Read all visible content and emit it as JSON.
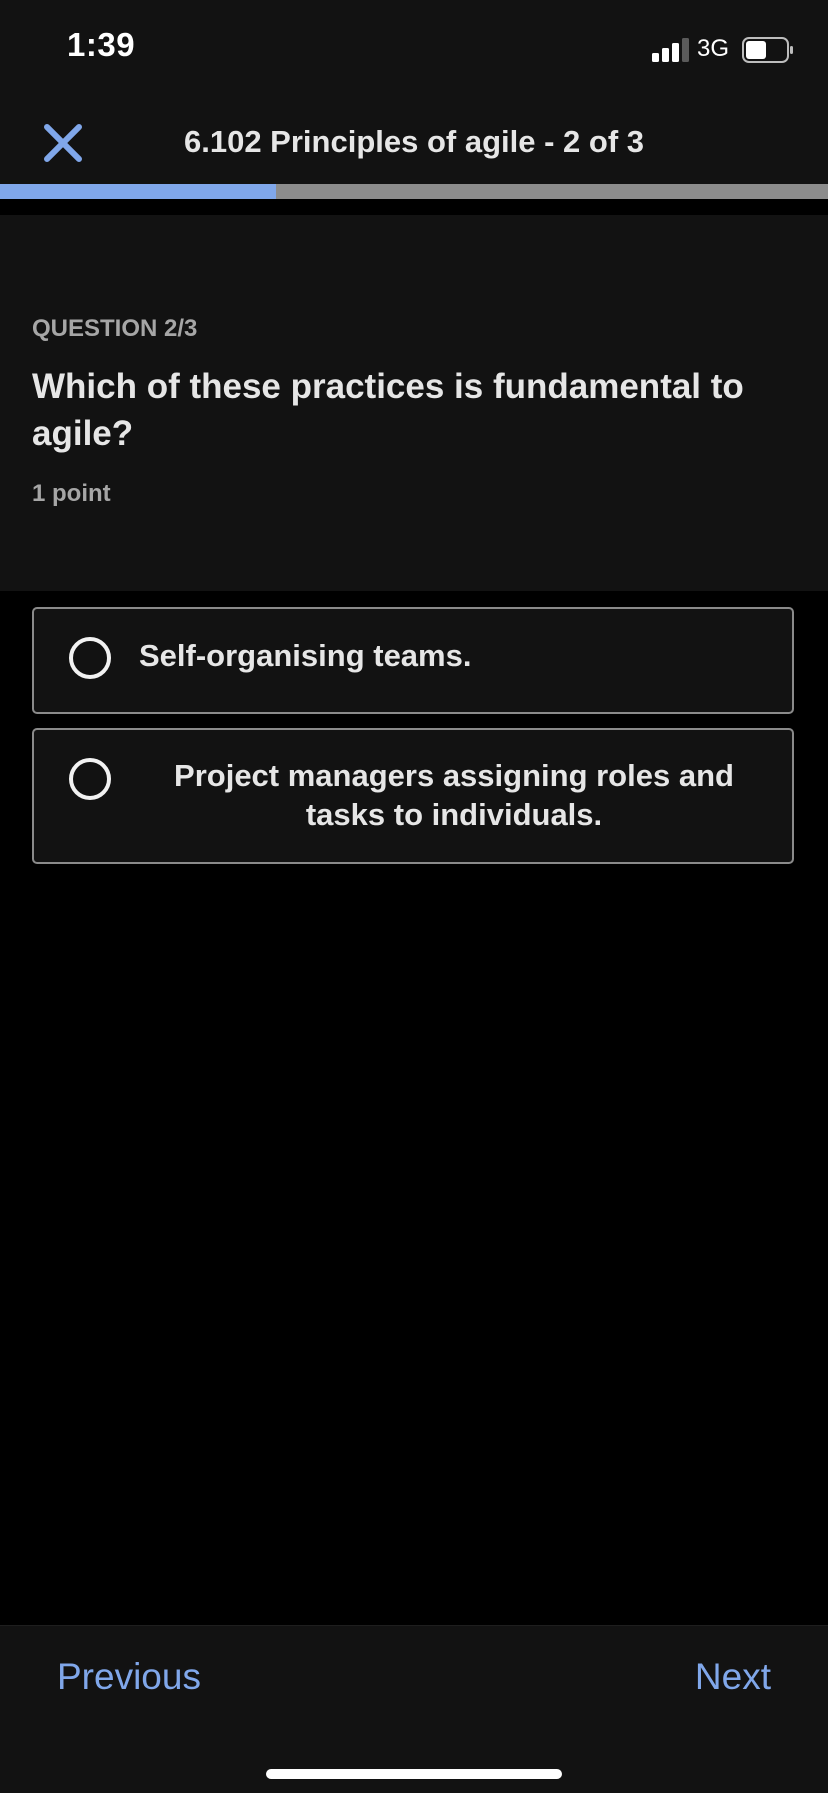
{
  "status_bar": {
    "time": "1:39",
    "network": "3G",
    "signal_icon": "cellular-signal-icon",
    "battery_icon": "battery-icon"
  },
  "header": {
    "close_icon": "close-icon",
    "title": "6.102 Principles of agile - 2 of 3",
    "progress_fraction": 0.333
  },
  "question": {
    "number_label": "QUESTION 2/3",
    "text": "Which of these practices is fundamental to agile?",
    "points": "1 point"
  },
  "options": [
    {
      "label": "Self-organising teams.",
      "selected": false
    },
    {
      "label": "Project managers assigning roles and tasks to individuals.",
      "selected": false
    }
  ],
  "footer": {
    "previous_label": "Previous",
    "next_label": "Next"
  },
  "colors": {
    "accent": "#80a7ea",
    "background": "#000000",
    "panel": "#121212"
  }
}
